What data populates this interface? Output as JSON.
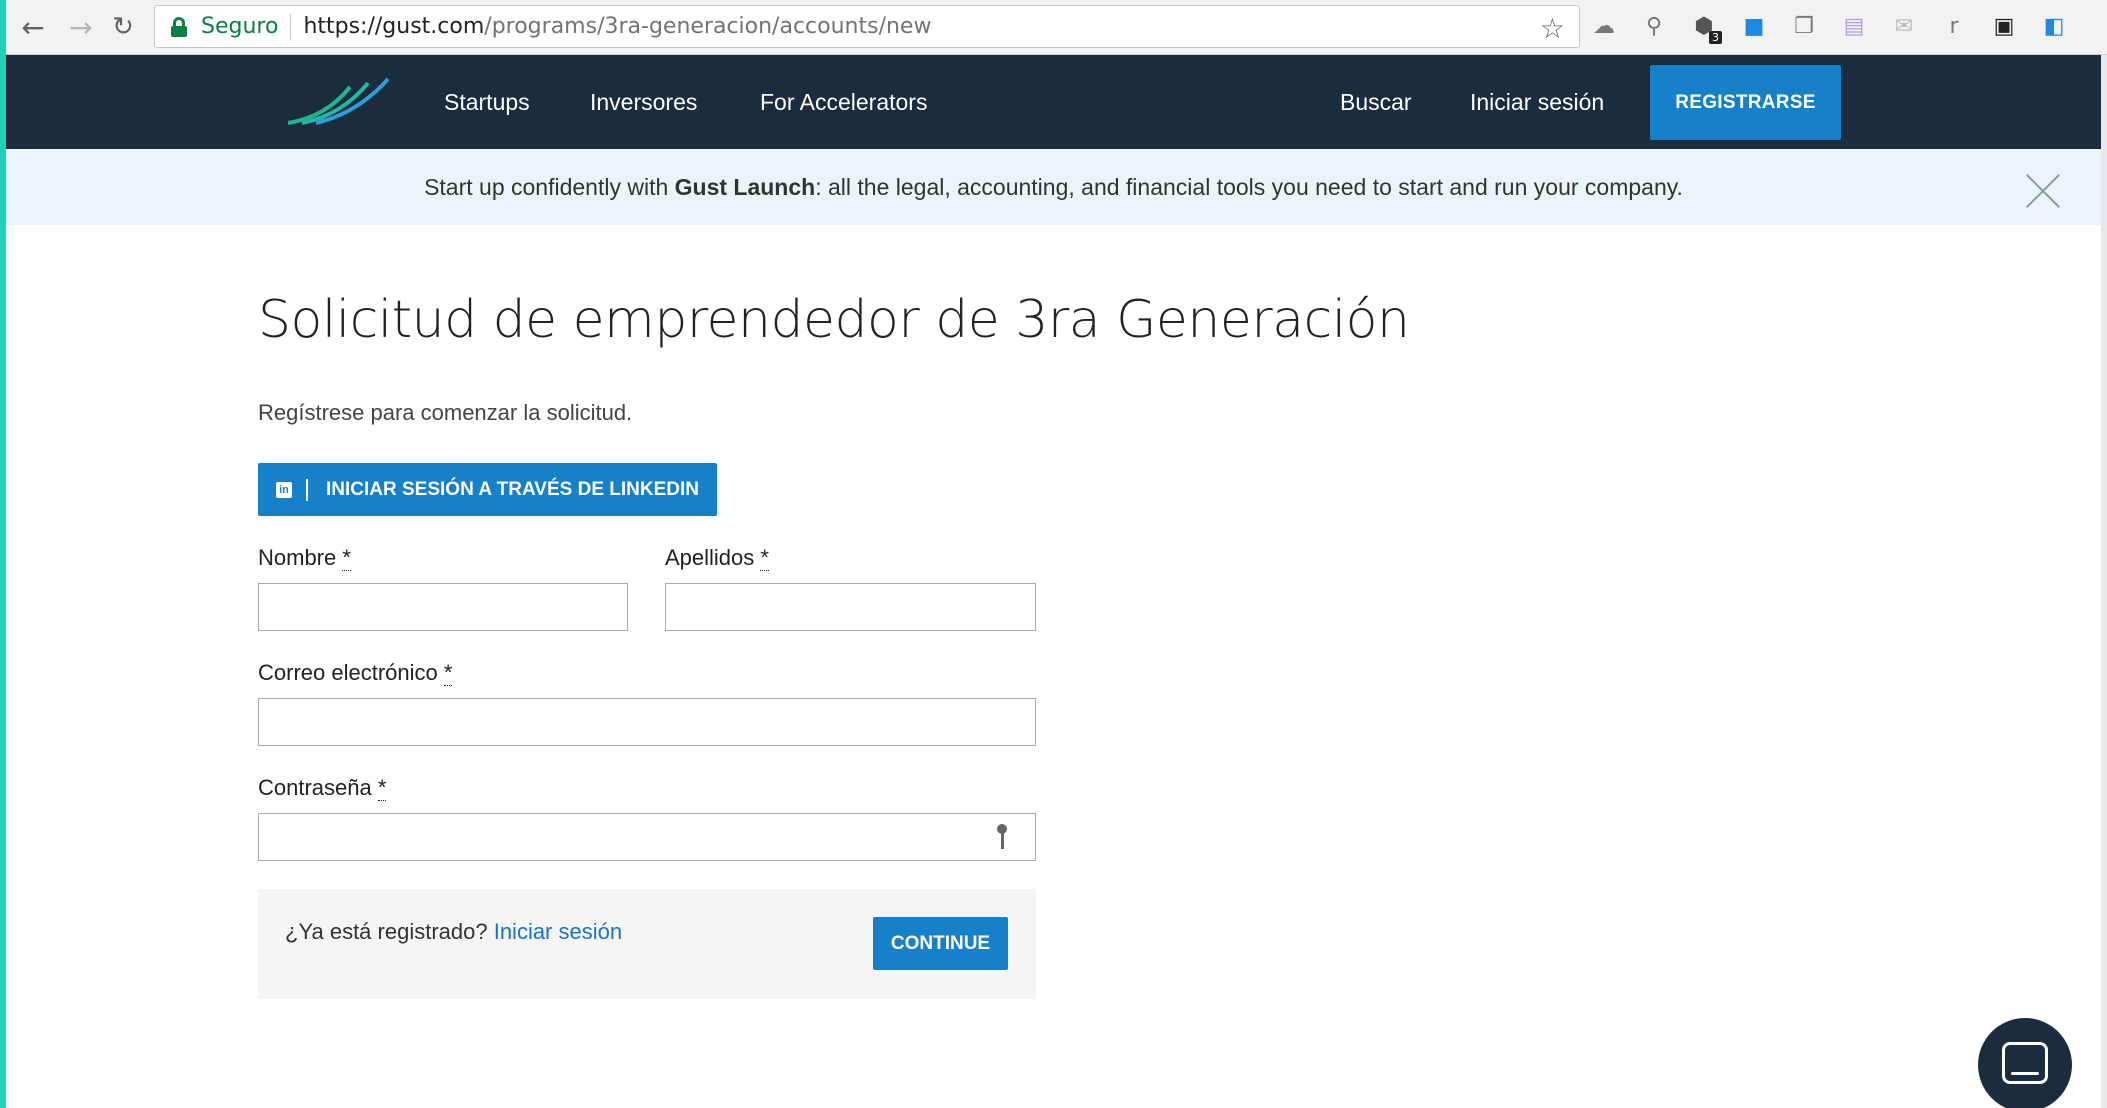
{
  "browser": {
    "secure_label": "Seguro",
    "url_host": "https://gust.com",
    "url_path": "/programs/3ra-generacion/accounts/new",
    "extension_badge": "3"
  },
  "nav": {
    "links": [
      "Startups",
      "Inversores",
      "For Accelerators"
    ],
    "search": "Buscar",
    "login": "Iniciar sesión",
    "register": "REGISTRARSE"
  },
  "banner": {
    "prefix": "Start up confidently with ",
    "bold": "Gust Launch",
    "suffix": ": all the legal, accounting, and financial tools you need to start and run your company."
  },
  "form": {
    "title": "Solicitud de emprendedor de 3ra Generación",
    "subtitle": "Regístrese para comenzar la solicitud.",
    "linkedin_label": "INICIAR SESIÓN A TRAVÉS DE LINKEDIN",
    "linkedin_icon": "in",
    "first_name_label": "Nombre",
    "last_name_label": "Apellidos",
    "email_label": "Correo electrónico",
    "password_label": "Contraseña",
    "required_mark": "*",
    "already_text": "¿Ya está registrado? ",
    "already_link": "Iniciar sesión",
    "continue": "CONTINUE"
  },
  "colors": {
    "nav_bg": "#1a2c3d",
    "accent": "#1680c8",
    "banner_bg": "#eaf4f9",
    "left_strip": "#1fd1b5"
  },
  "icons": [
    "back-icon",
    "forward-icon",
    "reload-icon",
    "lock-icon",
    "star-icon",
    "key-icon",
    "chat-icon",
    "close-icon"
  ]
}
